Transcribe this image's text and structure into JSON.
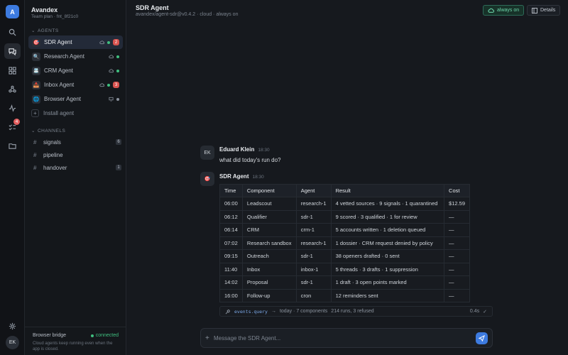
{
  "workspace": {
    "initial": "A",
    "org": "Avandex",
    "plan": "Team plan · fnt_8f21c0"
  },
  "rail": {
    "activity_badge": "4",
    "user_initials": "EK"
  },
  "sidebar": {
    "agents_heading": "AGENTS",
    "agents": [
      {
        "label": "SDR Agent",
        "count": "2",
        "icon": "dart-icon"
      },
      {
        "label": "Research Agent",
        "icon": "magnifier-icon"
      },
      {
        "label": "CRM Agent",
        "icon": "card-index-icon"
      },
      {
        "label": "Inbox Agent",
        "count": "3",
        "icon": "inbox-tray-icon"
      },
      {
        "label": "Browser Agent",
        "icon": "globe-icon"
      }
    ],
    "install_label": "Install agent",
    "channels_heading": "CHANNELS",
    "channels": [
      {
        "label": "signals",
        "count": "6"
      },
      {
        "label": "pipeline"
      },
      {
        "label": "handover",
        "count": "1"
      }
    ],
    "bridge": {
      "label": "Browser bridge",
      "status": "connected",
      "note": "Cloud agents keep running even when the app is closed."
    }
  },
  "header": {
    "title": "SDR Agent",
    "subtitle": "avandex/agent-sdr@v0.4.2 · cloud · always on",
    "always_on_label": "always on",
    "details_label": "Details"
  },
  "messages": [
    {
      "initials": "EK",
      "name": "Eduard Klein",
      "time": "18:30",
      "text": "what did today's run do?"
    },
    {
      "name": "SDR Agent",
      "time": "18:30"
    }
  ],
  "run_table": {
    "headers": [
      "Time",
      "Component",
      "Agent",
      "Result",
      "Cost"
    ],
    "rows": [
      [
        "06:00",
        "Leadscout",
        "research-1",
        "4 vetted sources · 9 signals · 1 quarantined",
        "$12.59"
      ],
      [
        "06:12",
        "Qualifier",
        "sdr-1",
        "9 scored · 3 qualified · 1 for review",
        "—"
      ],
      [
        "06:14",
        "CRM",
        "crm-1",
        "5 accounts written · 1 deletion queued",
        "—"
      ],
      [
        "07:02",
        "Research sandbox",
        "research-1",
        "1 dossier · CRM request denied by policy",
        "—"
      ],
      [
        "09:15",
        "Outreach",
        "sdr-1",
        "38 openers drafted · 0 sent",
        "—"
      ],
      [
        "11:40",
        "Inbox",
        "inbox-1",
        "5 threads · 3 drafts · 1 suppression",
        "—"
      ],
      [
        "14:02",
        "Proposal",
        "sdr-1",
        "1 draft · 3 open points marked",
        "—"
      ],
      [
        "16:00",
        "Follow-up",
        "cron",
        "12 reminders sent",
        "—"
      ]
    ]
  },
  "query": {
    "code": "events.query",
    "scope": "today · 7 components",
    "meta": "214 runs, 3 refused",
    "duration": "0.4s"
  },
  "composer": {
    "placeholder": "Message the SDR Agent..."
  },
  "colors": {
    "accent": "#3d7be0",
    "online": "#3fbf7f",
    "badge": "#d9534f"
  }
}
